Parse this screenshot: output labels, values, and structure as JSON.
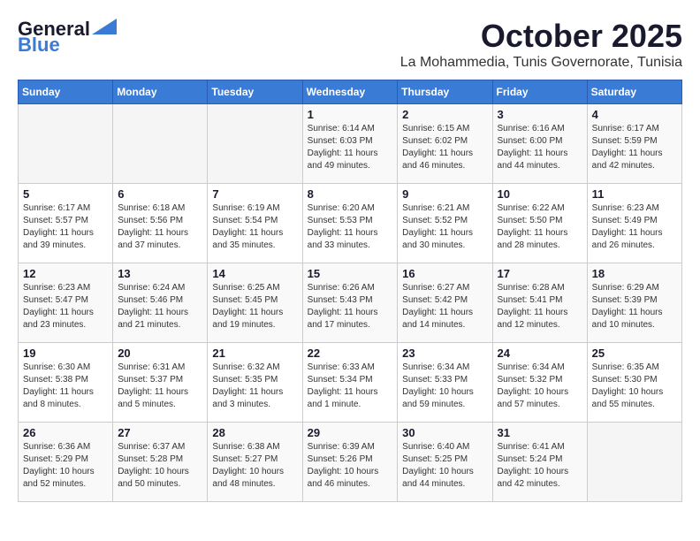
{
  "header": {
    "logo_general": "General",
    "logo_blue": "Blue",
    "title": "October 2025",
    "subtitle": "La Mohammedia, Tunis Governorate, Tunisia"
  },
  "days_of_week": [
    "Sunday",
    "Monday",
    "Tuesday",
    "Wednesday",
    "Thursday",
    "Friday",
    "Saturday"
  ],
  "weeks": [
    [
      {
        "day": "",
        "info": ""
      },
      {
        "day": "",
        "info": ""
      },
      {
        "day": "",
        "info": ""
      },
      {
        "day": "1",
        "info": "Sunrise: 6:14 AM\nSunset: 6:03 PM\nDaylight: 11 hours\nand 49 minutes."
      },
      {
        "day": "2",
        "info": "Sunrise: 6:15 AM\nSunset: 6:02 PM\nDaylight: 11 hours\nand 46 minutes."
      },
      {
        "day": "3",
        "info": "Sunrise: 6:16 AM\nSunset: 6:00 PM\nDaylight: 11 hours\nand 44 minutes."
      },
      {
        "day": "4",
        "info": "Sunrise: 6:17 AM\nSunset: 5:59 PM\nDaylight: 11 hours\nand 42 minutes."
      }
    ],
    [
      {
        "day": "5",
        "info": "Sunrise: 6:17 AM\nSunset: 5:57 PM\nDaylight: 11 hours\nand 39 minutes."
      },
      {
        "day": "6",
        "info": "Sunrise: 6:18 AM\nSunset: 5:56 PM\nDaylight: 11 hours\nand 37 minutes."
      },
      {
        "day": "7",
        "info": "Sunrise: 6:19 AM\nSunset: 5:54 PM\nDaylight: 11 hours\nand 35 minutes."
      },
      {
        "day": "8",
        "info": "Sunrise: 6:20 AM\nSunset: 5:53 PM\nDaylight: 11 hours\nand 33 minutes."
      },
      {
        "day": "9",
        "info": "Sunrise: 6:21 AM\nSunset: 5:52 PM\nDaylight: 11 hours\nand 30 minutes."
      },
      {
        "day": "10",
        "info": "Sunrise: 6:22 AM\nSunset: 5:50 PM\nDaylight: 11 hours\nand 28 minutes."
      },
      {
        "day": "11",
        "info": "Sunrise: 6:23 AM\nSunset: 5:49 PM\nDaylight: 11 hours\nand 26 minutes."
      }
    ],
    [
      {
        "day": "12",
        "info": "Sunrise: 6:23 AM\nSunset: 5:47 PM\nDaylight: 11 hours\nand 23 minutes."
      },
      {
        "day": "13",
        "info": "Sunrise: 6:24 AM\nSunset: 5:46 PM\nDaylight: 11 hours\nand 21 minutes."
      },
      {
        "day": "14",
        "info": "Sunrise: 6:25 AM\nSunset: 5:45 PM\nDaylight: 11 hours\nand 19 minutes."
      },
      {
        "day": "15",
        "info": "Sunrise: 6:26 AM\nSunset: 5:43 PM\nDaylight: 11 hours\nand 17 minutes."
      },
      {
        "day": "16",
        "info": "Sunrise: 6:27 AM\nSunset: 5:42 PM\nDaylight: 11 hours\nand 14 minutes."
      },
      {
        "day": "17",
        "info": "Sunrise: 6:28 AM\nSunset: 5:41 PM\nDaylight: 11 hours\nand 12 minutes."
      },
      {
        "day": "18",
        "info": "Sunrise: 6:29 AM\nSunset: 5:39 PM\nDaylight: 11 hours\nand 10 minutes."
      }
    ],
    [
      {
        "day": "19",
        "info": "Sunrise: 6:30 AM\nSunset: 5:38 PM\nDaylight: 11 hours\nand 8 minutes."
      },
      {
        "day": "20",
        "info": "Sunrise: 6:31 AM\nSunset: 5:37 PM\nDaylight: 11 hours\nand 5 minutes."
      },
      {
        "day": "21",
        "info": "Sunrise: 6:32 AM\nSunset: 5:35 PM\nDaylight: 11 hours\nand 3 minutes."
      },
      {
        "day": "22",
        "info": "Sunrise: 6:33 AM\nSunset: 5:34 PM\nDaylight: 11 hours\nand 1 minute."
      },
      {
        "day": "23",
        "info": "Sunrise: 6:34 AM\nSunset: 5:33 PM\nDaylight: 10 hours\nand 59 minutes."
      },
      {
        "day": "24",
        "info": "Sunrise: 6:34 AM\nSunset: 5:32 PM\nDaylight: 10 hours\nand 57 minutes."
      },
      {
        "day": "25",
        "info": "Sunrise: 6:35 AM\nSunset: 5:30 PM\nDaylight: 10 hours\nand 55 minutes."
      }
    ],
    [
      {
        "day": "26",
        "info": "Sunrise: 6:36 AM\nSunset: 5:29 PM\nDaylight: 10 hours\nand 52 minutes."
      },
      {
        "day": "27",
        "info": "Sunrise: 6:37 AM\nSunset: 5:28 PM\nDaylight: 10 hours\nand 50 minutes."
      },
      {
        "day": "28",
        "info": "Sunrise: 6:38 AM\nSunset: 5:27 PM\nDaylight: 10 hours\nand 48 minutes."
      },
      {
        "day": "29",
        "info": "Sunrise: 6:39 AM\nSunset: 5:26 PM\nDaylight: 10 hours\nand 46 minutes."
      },
      {
        "day": "30",
        "info": "Sunrise: 6:40 AM\nSunset: 5:25 PM\nDaylight: 10 hours\nand 44 minutes."
      },
      {
        "day": "31",
        "info": "Sunrise: 6:41 AM\nSunset: 5:24 PM\nDaylight: 10 hours\nand 42 minutes."
      },
      {
        "day": "",
        "info": ""
      }
    ]
  ]
}
